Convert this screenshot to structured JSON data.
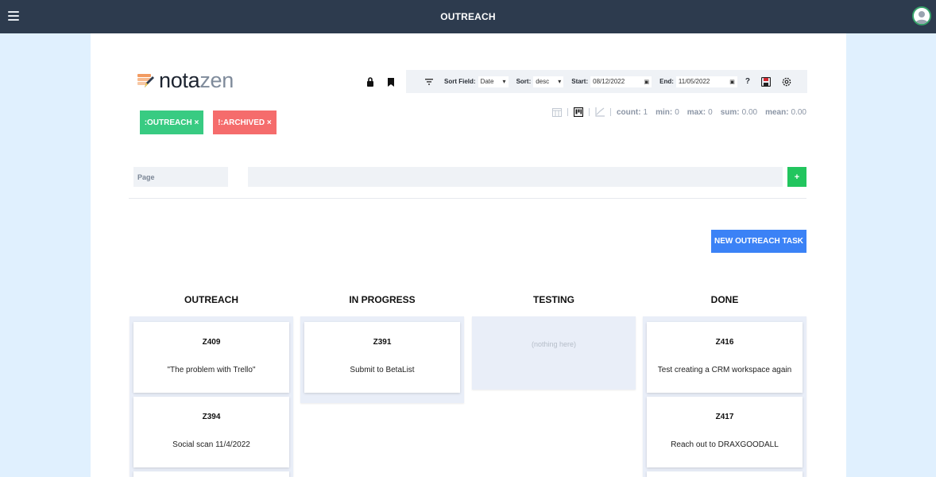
{
  "app": {
    "title": "OUTREACH"
  },
  "brand": {
    "part1": "nota",
    "part2": "zen"
  },
  "toolbar": {
    "sort_field_label": "Sort Field:",
    "sort_field_value": "Date",
    "sort_label": "Sort:",
    "sort_value": "desc",
    "start_label": "Start:",
    "start_value": "08/12/2022",
    "end_label": "End:",
    "end_value": "11/05/2022",
    "help_label": "?"
  },
  "tags": [
    {
      "label": ":OUTREACH ×",
      "color": "#38cb82"
    },
    {
      "label": "!:ARCHIVED ×",
      "color": "#f56c6c"
    }
  ],
  "stats": {
    "count_label": "count:",
    "count": "1",
    "min_label": "min:",
    "min": "0",
    "max_label": "max:",
    "max": "0",
    "sum_label": "sum:",
    "sum": "0.00",
    "mean_label": "mean:",
    "mean": "0.00"
  },
  "page_input": {
    "placeholder": "Page"
  },
  "add_label": "+",
  "new_task_label": "NEW OUTREACH TASK",
  "board": {
    "columns": [
      {
        "title": "OUTREACH",
        "cards": [
          {
            "id": "Z409",
            "title": "\"The problem with Trello\""
          },
          {
            "id": "Z394",
            "title": "Social scan 11/4/2022"
          }
        ]
      },
      {
        "title": "IN PROGRESS",
        "cards": [
          {
            "id": "Z391",
            "title": "Submit to BetaList"
          }
        ]
      },
      {
        "title": "TESTING",
        "empty_text": "(nothing here)",
        "cards": []
      },
      {
        "title": "DONE",
        "cards": [
          {
            "id": "Z416",
            "title": "Test creating a CRM workspace again"
          },
          {
            "id": "Z417",
            "title": "Reach out to DRAXGOODALL"
          }
        ]
      }
    ]
  },
  "colors": {
    "topbar": "#2d3b4e",
    "background": "#e0f0fe",
    "tag_green": "#38cb82",
    "tag_red": "#f56c6c",
    "primary": "#3b82f6",
    "add": "#22c55e"
  }
}
